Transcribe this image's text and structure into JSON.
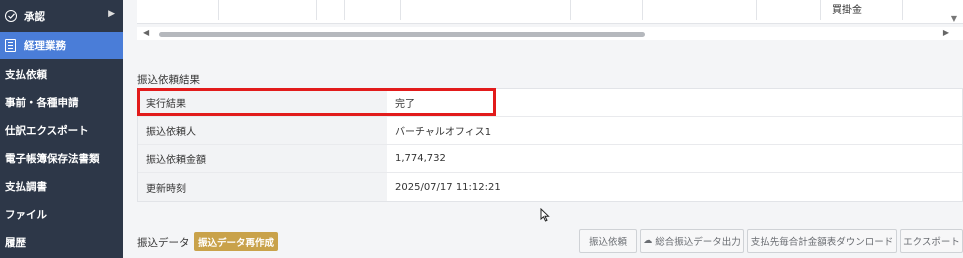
{
  "sidebar": {
    "items": [
      {
        "label": "承認",
        "icon": "check-circle-icon"
      },
      {
        "label": "経理業務",
        "icon": "document-icon"
      },
      {
        "label": "支払依頼"
      },
      {
        "label": "事前・各種申請"
      },
      {
        "label": "仕訳エクスポート"
      },
      {
        "label": "電子帳簿保存法書類"
      },
      {
        "label": "支払調書"
      },
      {
        "label": "ファイル"
      },
      {
        "label": "履歴"
      }
    ]
  },
  "upper_table": {
    "visible_cell": "買掛金"
  },
  "result_section": {
    "title": "振込依頼結果",
    "rows": [
      {
        "label": "実行結果",
        "value": "完了"
      },
      {
        "label": "振込依頼人",
        "value": "バーチャルオフィス1"
      },
      {
        "label": "振込依頼金額",
        "value": "1,774,732"
      },
      {
        "label": "更新時刻",
        "value": "2025/07/17 11:12:21"
      }
    ]
  },
  "bottom_bar": {
    "label": "振込データ",
    "recreate_button": "振込データ再作成",
    "buttons": [
      {
        "label": "振込依頼"
      },
      {
        "label": "総合振込データ出力",
        "icon": "cloud-download-icon"
      },
      {
        "label": "支払先毎合計金額表ダウンロード"
      },
      {
        "label": "エクスポート"
      }
    ]
  },
  "colors": {
    "sidebar_bg": "#2d3748",
    "sidebar_active": "#4a7dd8",
    "highlight_border": "#e21b1b",
    "recreate_button_bg": "#c9a24a"
  }
}
